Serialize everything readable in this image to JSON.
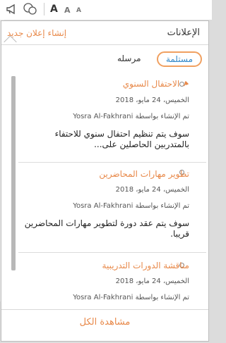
{
  "topbar": {
    "font_large": "A",
    "font_medium": "A",
    "font_small": "A"
  },
  "header": {
    "title": "الإعلانات",
    "create_link": "إنشاء إعلان جديد"
  },
  "tabs": {
    "received": "مستلمة",
    "sent": "مرسله"
  },
  "announcements": [
    {
      "title": "الاحتفال السنوي",
      "date": "الخميس، 24 مايو، 2018",
      "created_by": "تم الإنشاء بواسطة Yosra Al-Fakhrani",
      "body": "سوف يتم تنظيم احتفال سنوي للاحتفاء بالمتدربين الحاصلين على..."
    },
    {
      "title": "تطوير مهارات المحاضرين",
      "date": "الخميس، 24 مايو، 2018",
      "created_by": "تم الإنشاء بواسطة Yosra Al-Fakhrani",
      "body": "سوف يتم عقد دورة لتطوير مهارات المحاضرين قريبا."
    },
    {
      "title": "مناقشة الدورات التدريبية",
      "date": "الخميس، 24 مايو، 2018",
      "created_by": "تم الإنشاء بواسطة Yosra Al-Fakhrani",
      "body": ""
    }
  ],
  "footer": {
    "view_all": "مشاهدة الكل"
  },
  "colors": {
    "accent": "#e8894a",
    "tab_text": "#2e86c8"
  }
}
